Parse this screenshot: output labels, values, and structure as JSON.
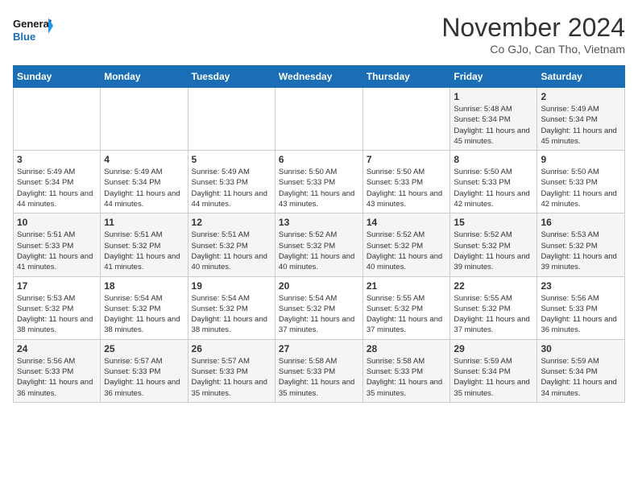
{
  "logo": {
    "line1": "General",
    "line2": "Blue"
  },
  "title": "November 2024",
  "location": "Co GJo, Can Tho, Vietnam",
  "days_of_week": [
    "Sunday",
    "Monday",
    "Tuesday",
    "Wednesday",
    "Thursday",
    "Friday",
    "Saturday"
  ],
  "weeks": [
    [
      {
        "day": "",
        "info": ""
      },
      {
        "day": "",
        "info": ""
      },
      {
        "day": "",
        "info": ""
      },
      {
        "day": "",
        "info": ""
      },
      {
        "day": "",
        "info": ""
      },
      {
        "day": "1",
        "info": "Sunrise: 5:48 AM\nSunset: 5:34 PM\nDaylight: 11 hours and 45 minutes."
      },
      {
        "day": "2",
        "info": "Sunrise: 5:49 AM\nSunset: 5:34 PM\nDaylight: 11 hours and 45 minutes."
      }
    ],
    [
      {
        "day": "3",
        "info": "Sunrise: 5:49 AM\nSunset: 5:34 PM\nDaylight: 11 hours and 44 minutes."
      },
      {
        "day": "4",
        "info": "Sunrise: 5:49 AM\nSunset: 5:34 PM\nDaylight: 11 hours and 44 minutes."
      },
      {
        "day": "5",
        "info": "Sunrise: 5:49 AM\nSunset: 5:33 PM\nDaylight: 11 hours and 44 minutes."
      },
      {
        "day": "6",
        "info": "Sunrise: 5:50 AM\nSunset: 5:33 PM\nDaylight: 11 hours and 43 minutes."
      },
      {
        "day": "7",
        "info": "Sunrise: 5:50 AM\nSunset: 5:33 PM\nDaylight: 11 hours and 43 minutes."
      },
      {
        "day": "8",
        "info": "Sunrise: 5:50 AM\nSunset: 5:33 PM\nDaylight: 11 hours and 42 minutes."
      },
      {
        "day": "9",
        "info": "Sunrise: 5:50 AM\nSunset: 5:33 PM\nDaylight: 11 hours and 42 minutes."
      }
    ],
    [
      {
        "day": "10",
        "info": "Sunrise: 5:51 AM\nSunset: 5:33 PM\nDaylight: 11 hours and 41 minutes."
      },
      {
        "day": "11",
        "info": "Sunrise: 5:51 AM\nSunset: 5:32 PM\nDaylight: 11 hours and 41 minutes."
      },
      {
        "day": "12",
        "info": "Sunrise: 5:51 AM\nSunset: 5:32 PM\nDaylight: 11 hours and 40 minutes."
      },
      {
        "day": "13",
        "info": "Sunrise: 5:52 AM\nSunset: 5:32 PM\nDaylight: 11 hours and 40 minutes."
      },
      {
        "day": "14",
        "info": "Sunrise: 5:52 AM\nSunset: 5:32 PM\nDaylight: 11 hours and 40 minutes."
      },
      {
        "day": "15",
        "info": "Sunrise: 5:52 AM\nSunset: 5:32 PM\nDaylight: 11 hours and 39 minutes."
      },
      {
        "day": "16",
        "info": "Sunrise: 5:53 AM\nSunset: 5:32 PM\nDaylight: 11 hours and 39 minutes."
      }
    ],
    [
      {
        "day": "17",
        "info": "Sunrise: 5:53 AM\nSunset: 5:32 PM\nDaylight: 11 hours and 38 minutes."
      },
      {
        "day": "18",
        "info": "Sunrise: 5:54 AM\nSunset: 5:32 PM\nDaylight: 11 hours and 38 minutes."
      },
      {
        "day": "19",
        "info": "Sunrise: 5:54 AM\nSunset: 5:32 PM\nDaylight: 11 hours and 38 minutes."
      },
      {
        "day": "20",
        "info": "Sunrise: 5:54 AM\nSunset: 5:32 PM\nDaylight: 11 hours and 37 minutes."
      },
      {
        "day": "21",
        "info": "Sunrise: 5:55 AM\nSunset: 5:32 PM\nDaylight: 11 hours and 37 minutes."
      },
      {
        "day": "22",
        "info": "Sunrise: 5:55 AM\nSunset: 5:32 PM\nDaylight: 11 hours and 37 minutes."
      },
      {
        "day": "23",
        "info": "Sunrise: 5:56 AM\nSunset: 5:33 PM\nDaylight: 11 hours and 36 minutes."
      }
    ],
    [
      {
        "day": "24",
        "info": "Sunrise: 5:56 AM\nSunset: 5:33 PM\nDaylight: 11 hours and 36 minutes."
      },
      {
        "day": "25",
        "info": "Sunrise: 5:57 AM\nSunset: 5:33 PM\nDaylight: 11 hours and 36 minutes."
      },
      {
        "day": "26",
        "info": "Sunrise: 5:57 AM\nSunset: 5:33 PM\nDaylight: 11 hours and 35 minutes."
      },
      {
        "day": "27",
        "info": "Sunrise: 5:58 AM\nSunset: 5:33 PM\nDaylight: 11 hours and 35 minutes."
      },
      {
        "day": "28",
        "info": "Sunrise: 5:58 AM\nSunset: 5:33 PM\nDaylight: 11 hours and 35 minutes."
      },
      {
        "day": "29",
        "info": "Sunrise: 5:59 AM\nSunset: 5:34 PM\nDaylight: 11 hours and 35 minutes."
      },
      {
        "day": "30",
        "info": "Sunrise: 5:59 AM\nSunset: 5:34 PM\nDaylight: 11 hours and 34 minutes."
      }
    ]
  ]
}
